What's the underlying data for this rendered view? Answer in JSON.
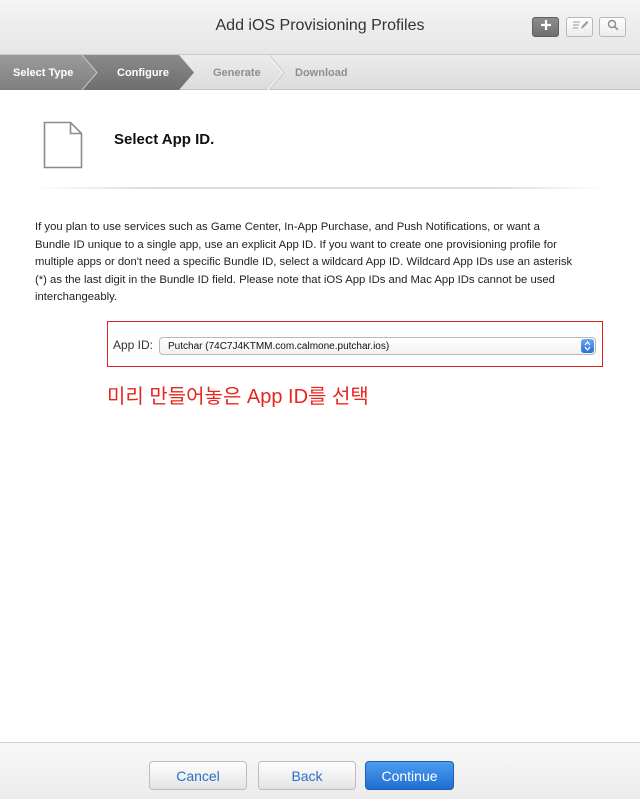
{
  "header": {
    "title": "Add iOS Provisioning Profiles",
    "buttons": {
      "add_icon": "plus-icon",
      "edit_icon": "edit-icon",
      "search_icon": "search-icon"
    }
  },
  "steps": [
    {
      "label": "Select Type",
      "state": "completed"
    },
    {
      "label": "Configure",
      "state": "current"
    },
    {
      "label": "Generate",
      "state": "pending"
    },
    {
      "label": "Download",
      "state": "pending"
    }
  ],
  "main": {
    "heading": "Select App ID.",
    "description": "If you plan to use services such as Game Center, In-App Purchase, and Push Notifications, or want a Bundle ID unique to a single app, use an explicit App ID. If you want to create one provisioning profile for multiple apps or don't need a specific Bundle ID, select a wildcard App ID. Wildcard App IDs use an asterisk (*) as the last digit in the Bundle ID field. Please note that iOS App IDs and Mac App IDs cannot be used interchangeably.",
    "app_id_label": "App ID:",
    "app_id_value": "Putchar (74C7J4KTMM.com.calmone.putchar.ios)",
    "annotation": "미리 만들어놓은 App ID를 선택"
  },
  "footer": {
    "cancel": "Cancel",
    "back": "Back",
    "continue": "Continue"
  },
  "colors": {
    "accent_blue": "#1e6fd2",
    "annotation_red": "#e8261f",
    "active_step": "#7a7a7a"
  }
}
